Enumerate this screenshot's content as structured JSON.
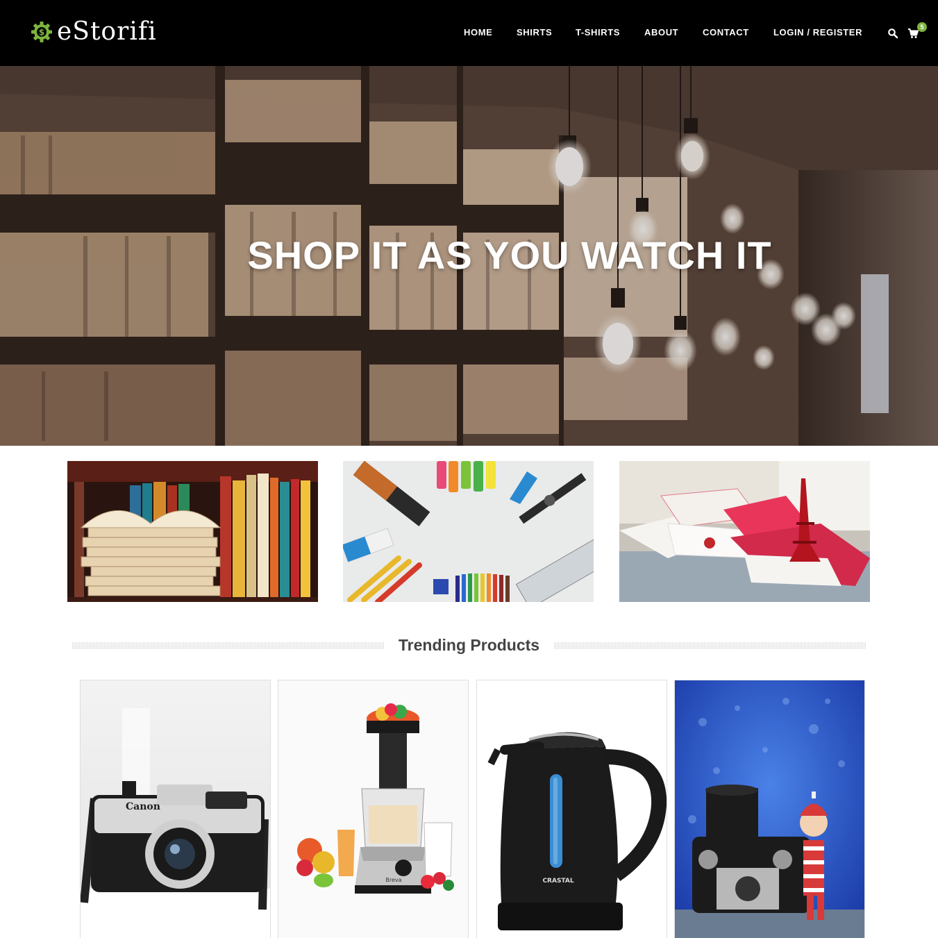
{
  "header": {
    "logo_text": "eStorifi",
    "nav": [
      "HOME",
      "SHIRTS",
      "T-SHIRTS",
      "ABOUT",
      "CONTACT",
      "LOGIN / REGISTER"
    ],
    "cart_count": "5"
  },
  "hero": {
    "title": "SHOP IT AS YOU WATCH IT"
  },
  "categories": [
    {
      "name": "books-category"
    },
    {
      "name": "stationery-category"
    },
    {
      "name": "cards-category"
    }
  ],
  "section": {
    "title": "Trending Products"
  },
  "products": [
    {
      "image": "canon-camera",
      "brand_label": "Canon"
    },
    {
      "image": "juicer",
      "brand_label": "Breva"
    },
    {
      "image": "kettle",
      "brand_label": "CRASTAL"
    },
    {
      "image": "camera-with-doll",
      "brand_label": ""
    }
  ],
  "colors": {
    "header_bg": "#000000",
    "accent": "#7db53d",
    "section_title": "#444444"
  }
}
